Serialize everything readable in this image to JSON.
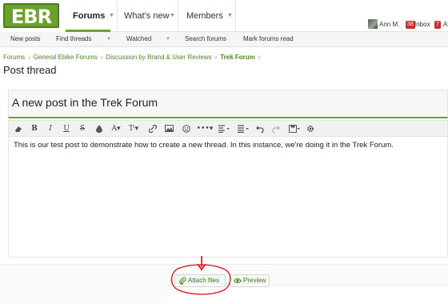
{
  "header": {
    "logo_text": "EBR",
    "tabs": [
      {
        "label": "Forums",
        "active": true
      },
      {
        "label": "What's new"
      },
      {
        "label": "Members"
      }
    ],
    "user": {
      "name": "Ann M.",
      "inbox_count": "38",
      "inbox_label": "Inbox",
      "alerts_count": "7",
      "alerts_label": "A"
    }
  },
  "subnav": {
    "items": [
      "New posts",
      "Find threads",
      "Watched",
      "Search forums",
      "Mark forums read"
    ]
  },
  "breadcrumb": {
    "items": [
      "Forums",
      "General Ebike Forums",
      "Discussion by Brand & User Reviews"
    ],
    "current": "Trek Forum"
  },
  "page": {
    "title": "Post thread"
  },
  "form": {
    "thread_title": "A new post in the Trek Forum",
    "body_text": "This is our test post to demonstrate how to create a new thread. In this instance, we're doing it in the Trek Forum.",
    "attach_label": "Attach files",
    "preview_label": "Preview"
  },
  "toolbar": {
    "icons": [
      "eraser-icon",
      "bold-icon",
      "italic-icon",
      "underline-icon",
      "strikethrough-icon",
      "text-color-icon",
      "font-size-icon",
      "font-family-icon",
      "link-icon",
      "image-icon",
      "smilie-icon",
      "more-icon",
      "align-icon",
      "list-icon",
      "undo-icon",
      "redo-icon",
      "save-draft-icon",
      "settings-icon"
    ]
  },
  "colors": {
    "accent": "#6aa22b",
    "link": "#4e8a1e",
    "annotation": "#e0101a"
  }
}
